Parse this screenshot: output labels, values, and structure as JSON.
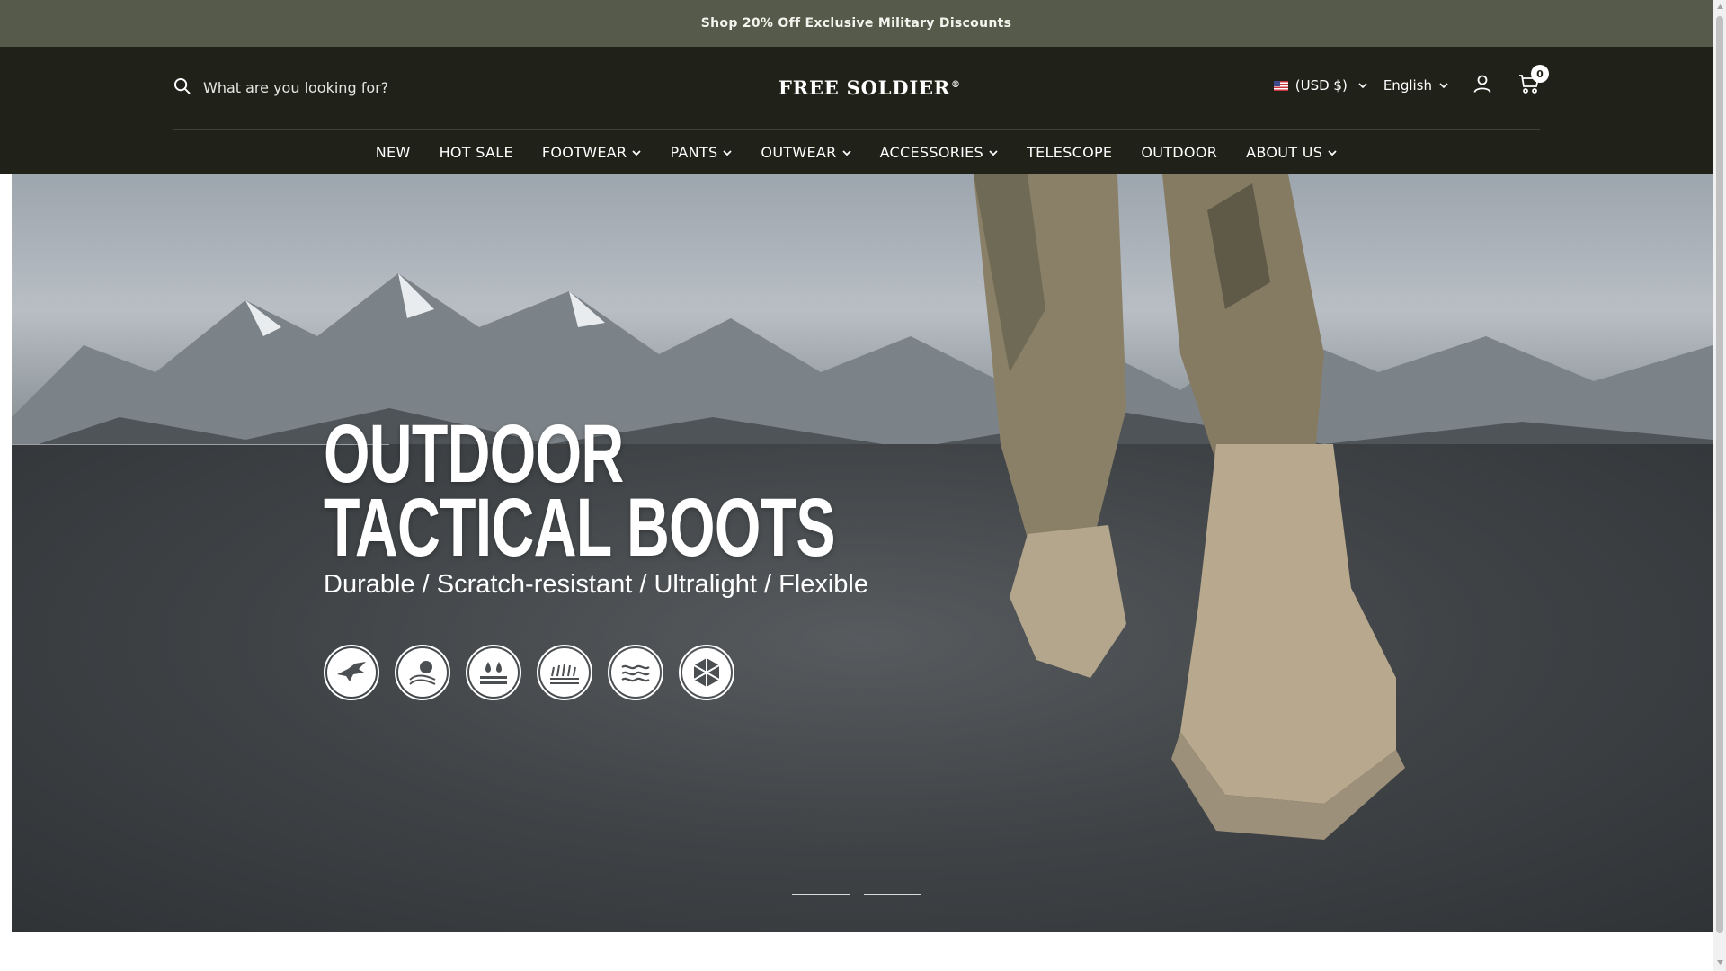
{
  "announcement": {
    "text": "Shop 20% Off Exclusive Military Discounts"
  },
  "header": {
    "search_placeholder": "What are you looking for?",
    "logo": "FREE SOLDIER",
    "logo_mark": "®",
    "currency": "(USD $)",
    "language": "English",
    "cart_count": "0"
  },
  "nav": [
    {
      "label": "NEW",
      "dropdown": false
    },
    {
      "label": "HOT SALE",
      "dropdown": false
    },
    {
      "label": "FOOTWEAR",
      "dropdown": true
    },
    {
      "label": "PANTS",
      "dropdown": true
    },
    {
      "label": "OUTWEAR",
      "dropdown": true
    },
    {
      "label": "ACCESSORIES",
      "dropdown": true
    },
    {
      "label": "TELESCOPE",
      "dropdown": false
    },
    {
      "label": "OUTDOOR",
      "dropdown": false
    },
    {
      "label": "ABOUT US",
      "dropdown": true
    }
  ],
  "hero": {
    "title_line1": "OUTDOOR",
    "title_line2": "TACTICAL BOOTS",
    "subtitle": "Durable / Scratch-resistant / Ultralight / Flexible",
    "features": [
      "eagle-icon",
      "moon-wave-icon",
      "water-drops-icon",
      "grass-field-icon",
      "water-waves-icon",
      "hexagon-shield-icon"
    ],
    "slides": 2
  },
  "colors": {
    "announcement_bg": "#565a4b",
    "header_bg": "#202118",
    "text": "#ffffff"
  }
}
